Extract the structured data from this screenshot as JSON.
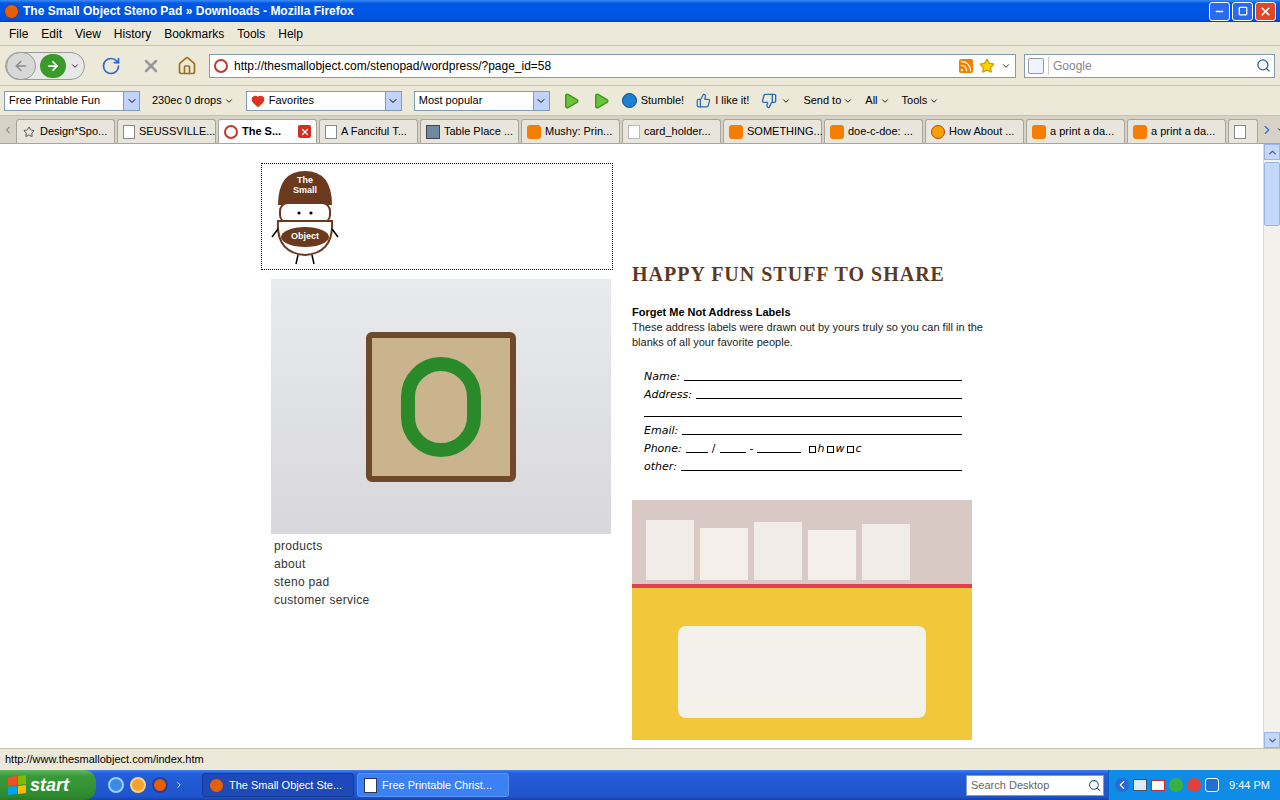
{
  "window": {
    "title": "The Small Object Steno Pad » Downloads - Mozilla Firefox"
  },
  "menu": [
    "File",
    "Edit",
    "View",
    "History",
    "Bookmarks",
    "Tools",
    "Help"
  ],
  "navigation": {
    "url": "http://thesmallobject.com/stenopad/wordpress/?page_id=58",
    "search_placeholder": "Google"
  },
  "toolbar": [
    {
      "kind": "select",
      "label": "Free Printable Fun"
    },
    {
      "kind": "menu",
      "label": "230ec 0 drops"
    },
    {
      "kind": "favorites",
      "label": "Favorites"
    },
    {
      "kind": "select",
      "label": "Most popular"
    },
    {
      "kind": "play",
      "label": ""
    },
    {
      "kind": "play",
      "label": ""
    },
    {
      "kind": "stumble",
      "label": "Stumble!"
    },
    {
      "kind": "like",
      "label": "I like it!"
    },
    {
      "kind": "dislike",
      "label": ""
    },
    {
      "kind": "menu",
      "label": "Send to"
    },
    {
      "kind": "menu",
      "label": "All"
    },
    {
      "kind": "menu",
      "label": "Tools"
    }
  ],
  "tabs": [
    {
      "label": "Design*Spo...",
      "kind": "star",
      "selected": false
    },
    {
      "label": "SEUSSVILLE...",
      "kind": "page",
      "selected": false
    },
    {
      "label": "The S...",
      "kind": "site",
      "selected": true
    },
    {
      "label": "A Fanciful T...",
      "kind": "page",
      "selected": false
    },
    {
      "label": "Table Place ...",
      "kind": "photo",
      "selected": false
    },
    {
      "label": "Mushy: Prin...",
      "kind": "blogger",
      "selected": false
    },
    {
      "label": "card_holder...",
      "kind": "blank",
      "selected": false
    },
    {
      "label": "SOMETHING...",
      "kind": "blogger",
      "selected": false
    },
    {
      "label": "doe-c-doe: ...",
      "kind": "blogger",
      "selected": false
    },
    {
      "label": "How About ...",
      "kind": "fire",
      "selected": false
    },
    {
      "label": "a print a da...",
      "kind": "blogger",
      "selected": false
    },
    {
      "label": "a print a da...",
      "kind": "blogger",
      "selected": false
    }
  ],
  "page": {
    "logo": {
      "line1": "The",
      "line2": "Small",
      "line3": "Object"
    },
    "links": [
      "products",
      "about",
      "steno pad",
      "customer service"
    ],
    "heading": "HAPPY FUN STUFF TO SHARE",
    "article_title": "Forget Me Not Address Labels",
    "article_text": "These address labels were drawn out by yours truly so you can fill in the blanks of all your favorite people.",
    "label_form": [
      {
        "kind": "line",
        "label": "Name:"
      },
      {
        "kind": "line",
        "label": "Address:"
      },
      {
        "kind": "blank",
        "label": ""
      },
      {
        "kind": "line",
        "label": "Email:"
      },
      {
        "kind": "phone",
        "label": "Phone:"
      },
      {
        "kind": "line",
        "label": "other:"
      }
    ],
    "phone_separators": [
      "/",
      "-"
    ],
    "phone_options": [
      "h",
      "w",
      "c"
    ]
  },
  "status_bar": "http://www.thesmallobject.com/index.htm",
  "taskbar": {
    "start": "start",
    "tasks": [
      {
        "label": "The Small Object Ste...",
        "kind": "firefox",
        "selected": true
      },
      {
        "label": "Free Printable Christ...",
        "kind": "document",
        "selected": false
      }
    ],
    "search_placeholder": "Search Desktop",
    "time": "9:44 PM"
  }
}
